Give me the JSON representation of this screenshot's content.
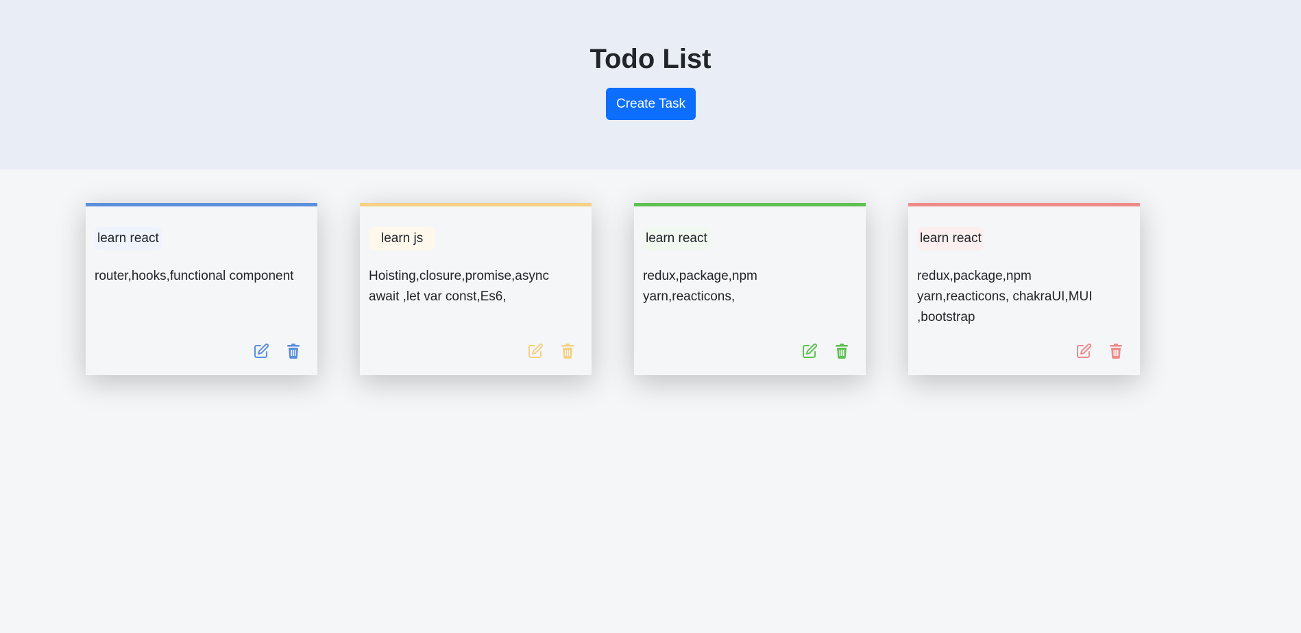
{
  "header": {
    "title": "Todo List",
    "create_button_label": "Create Task"
  },
  "cards": [
    {
      "name": "learn react",
      "description": "router,hooks,functional component",
      "primary_color": "#5a8fdc",
      "secondary_color": "#eef3fc"
    },
    {
      "name": "learn js",
      "description": "Hoisting,closure,promise,async await ,let var const,Es6,",
      "primary_color": "#f6d083",
      "secondary_color": "#fef8ec"
    },
    {
      "name": "learn react",
      "description": "redux,package,npm yarn,reacticons,",
      "primary_color": "#5dc152",
      "secondary_color": "#f0f8ef"
    },
    {
      "name": "learn react",
      "description": "redux,package,npm yarn,reacticons, chakraUI,MUI ,bootstrap",
      "primary_color": "#ef8a8a",
      "secondary_color": "#fcefef"
    }
  ],
  "icons": {
    "edit": "edit-icon",
    "delete": "trash-icon"
  }
}
